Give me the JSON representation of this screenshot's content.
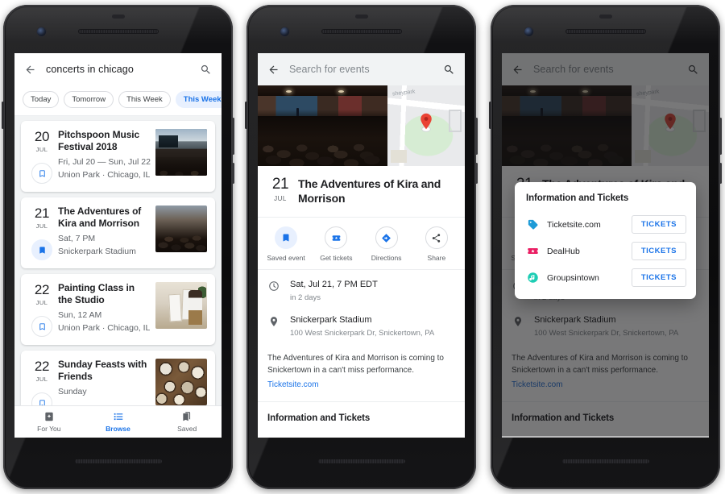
{
  "phones": {
    "search_list": {
      "searchbar": {
        "back_icon": "arrow-back-icon",
        "query": "concerts in chicago",
        "search_icon": "search-icon"
      },
      "chips": [
        {
          "label": "Today",
          "active": false
        },
        {
          "label": "Tomorrow",
          "active": false
        },
        {
          "label": "This Week",
          "active": false
        },
        {
          "label": "This Weekend",
          "active": true
        }
      ],
      "events": [
        {
          "day": "20",
          "month": "JUL",
          "title": "Pitchspoon Music Festival 2018",
          "when": "Fri, Jul 20 — Sun, Jul 22",
          "venue": "Union Park · Chicago, IL",
          "saved": false,
          "bookmark_icon": "bookmark-outline-icon",
          "thumb": "festival-stage-photo"
        },
        {
          "day": "21",
          "month": "JUL",
          "title": "The Adventures of Kira and Morrison",
          "when": "Sat, 7 PM",
          "venue": "Snickerpark Stadium",
          "saved": true,
          "bookmark_icon": "bookmark-filled-icon",
          "thumb": "concert-crowd-photo"
        },
        {
          "day": "22",
          "month": "JUL",
          "title": "Painting Class in the Studio",
          "when": "Sun, 12 AM",
          "venue": "Union Park · Chicago, IL",
          "saved": false,
          "bookmark_icon": "bookmark-outline-icon",
          "thumb": "painting-studio-photo"
        },
        {
          "day": "22",
          "month": "JUL",
          "title": "Sunday Feasts with Friends",
          "when": "Sunday",
          "venue": "",
          "saved": false,
          "bookmark_icon": "bookmark-outline-icon",
          "thumb": "food-table-photo"
        }
      ],
      "bottom_nav": [
        {
          "label": "For You",
          "icon": "sparkle-badge-icon",
          "active": false
        },
        {
          "label": "Browse",
          "icon": "list-icon",
          "active": true
        },
        {
          "label": "Saved",
          "icon": "bookmarks-stack-icon",
          "active": false
        }
      ]
    },
    "event_detail": {
      "searchbar": {
        "back_icon": "arrow-back-icon",
        "placeholder": "Search for events",
        "search_icon": "search-icon"
      },
      "hero": {
        "photo": "concert-crowd-photo",
        "map_label": "sheypark",
        "map_pin_icon": "map-pin-icon"
      },
      "header": {
        "day": "21",
        "month": "JUL",
        "title": "The Adventures of Kira and Morrison"
      },
      "actions": [
        {
          "label": "Saved event",
          "icon": "bookmark-filled-icon",
          "active": true
        },
        {
          "label": "Get tickets",
          "icon": "ticket-icon",
          "active": false
        },
        {
          "label": "Directions",
          "icon": "directions-icon",
          "active": false
        },
        {
          "label": "Share",
          "icon": "share-icon",
          "active": false
        }
      ],
      "time_row": {
        "icon": "clock-icon",
        "main": "Sat, Jul 21, 7 PM EDT",
        "sub": "in 2 days"
      },
      "place_row": {
        "icon": "location-pin-icon",
        "main": "Snickerpark Stadium",
        "sub": "100 West Snickerpark Dr, Snickertown, PA"
      },
      "description": {
        "text": "The Adventures of Kira and Morrison is coming to Snickertown in a can't miss performance.",
        "link": "Ticketsite.com"
      },
      "section_title": "Information and Tickets"
    },
    "tickets_dialog": {
      "title": "Information and Tickets",
      "vendors": [
        {
          "name": "Ticketsite.com",
          "icon": "price-tag-icon",
          "icon_color": "#1e9bd7",
          "button": "TICKETS"
        },
        {
          "name": "DealHub",
          "icon": "ticket-star-icon",
          "icon_color": "#ea1e63",
          "button": "TICKETS"
        },
        {
          "name": "Groupsintown",
          "icon": "music-note-circle-icon",
          "icon_color": "#1ecdb4",
          "button": "TICKETS"
        }
      ]
    }
  },
  "colors": {
    "accent_blue": "#1a73e8",
    "chip_active_bg": "#e8f0fe",
    "text_primary": "#202124",
    "text_secondary": "#5f6368",
    "surface_grey": "#f1f3f4",
    "pin_red": "#ea4335"
  }
}
